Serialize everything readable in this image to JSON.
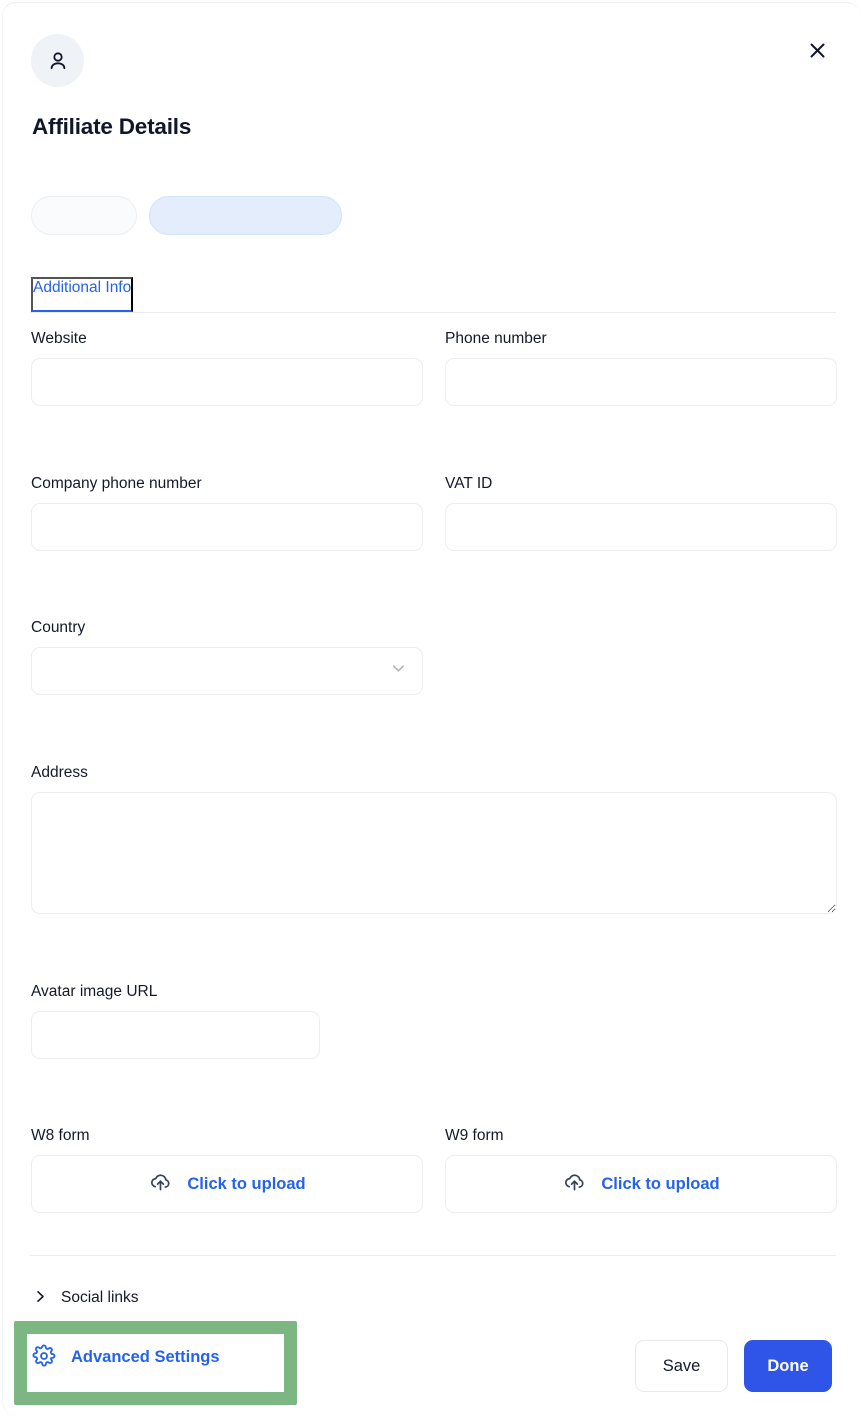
{
  "dialog": {
    "title": "Affiliate Details",
    "avatar_icon": "user-icon",
    "close_icon": "close-icon"
  },
  "chips": [
    {
      "name": "status-chip-placeholder",
      "label": "",
      "variant": "grey"
    },
    {
      "name": "role-chip-placeholder",
      "label": "",
      "variant": "blue"
    }
  ],
  "tabs": [
    {
      "label": "Additional Info",
      "active": true
    }
  ],
  "fields": {
    "website": {
      "label": "Website",
      "value": "",
      "placeholder": ""
    },
    "phone_number": {
      "label": "Phone number",
      "value": "",
      "placeholder": ""
    },
    "company_phone_number": {
      "label": "Company phone number",
      "value": "",
      "placeholder": ""
    },
    "vat_id": {
      "label": "VAT ID",
      "value": "",
      "placeholder": ""
    },
    "country": {
      "label": "Country",
      "value": "",
      "placeholder": "",
      "chevron_icon": "chevron-down-icon"
    },
    "address": {
      "label": "Address",
      "value": "",
      "placeholder": ""
    },
    "avatar_image_url": {
      "label": "Avatar image URL",
      "value": "",
      "placeholder": ""
    },
    "w8_form": {
      "label": "W8 form",
      "upload_label": "Click to upload",
      "upload_icon": "cloud-upload-icon"
    },
    "w9_form": {
      "label": "W9 form",
      "upload_label": "Click to upload",
      "upload_icon": "cloud-upload-icon"
    }
  },
  "footer": {
    "social_links_label": "Social links",
    "social_links_icon": "chevron-right-icon",
    "advanced_settings_label": "Advanced Settings",
    "advanced_settings_icon": "gear-icon",
    "save_label": "Save",
    "done_label": "Done"
  },
  "colors": {
    "accent_blue": "#2563eb",
    "primary_button_blue": "#2f55e8",
    "chip_blue_bg": "#e4edfb",
    "avatar_bg": "#eff2f7",
    "annotation_green": "#7cb683",
    "text_dark": "#15192a",
    "border_grey": "#ebedf0"
  }
}
